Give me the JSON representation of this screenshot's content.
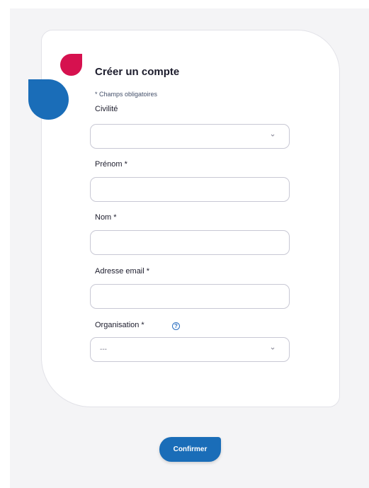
{
  "form": {
    "title": "Créer un compte",
    "required_note": "* Champs obligatoires",
    "fields": {
      "civilite": {
        "label": "Civilité",
        "value": ""
      },
      "prenom": {
        "label": "Prénom *",
        "value": ""
      },
      "nom": {
        "label": "Nom *",
        "value": ""
      },
      "email": {
        "label": "Adresse email *",
        "value": ""
      },
      "organisation": {
        "label": "Organisation *",
        "value": "---"
      }
    },
    "help_icon_glyph": "?",
    "confirm_label": "Confirmer"
  },
  "colors": {
    "brand_blue": "#1a6db8",
    "brand_red": "#d6114f",
    "background": "#f4f4f6"
  },
  "icons": [
    "chevron-down-icon",
    "help-icon",
    "logo-leaf-red",
    "logo-leaf-blue"
  ]
}
